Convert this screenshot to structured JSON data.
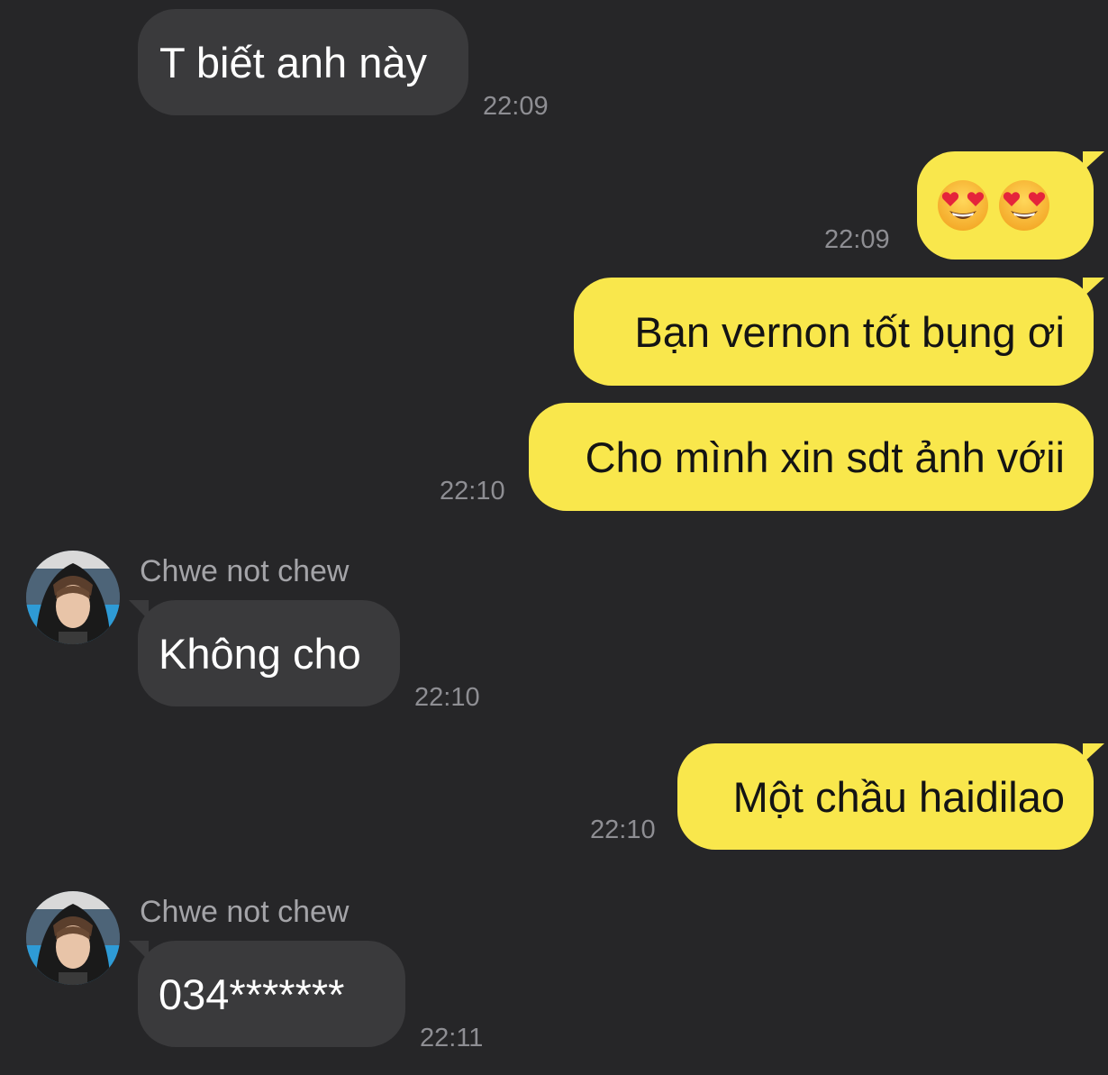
{
  "conversation": {
    "messages": [
      {
        "direction": "in",
        "text": "T biết anh này",
        "time": "22:09"
      },
      {
        "direction": "out",
        "text": "😍😍",
        "time": "22:09"
      },
      {
        "direction": "out",
        "text": "Bạn vernon tốt bụng ơi",
        "time": ""
      },
      {
        "direction": "out",
        "text": "Cho mình xin sdt ảnh vớii",
        "time": "22:10"
      },
      {
        "direction": "in",
        "sender": "Chwe not chew",
        "text": "Không cho",
        "time": "22:10"
      },
      {
        "direction": "out",
        "text": "Một chầu haidilao",
        "time": "22:10"
      },
      {
        "direction": "in",
        "sender": "Chwe not chew",
        "text": "034*******",
        "time": "22:11"
      }
    ]
  },
  "colors": {
    "background": "#262628",
    "incoming_bubble": "#3a3a3c",
    "outgoing_bubble": "#f9e74c",
    "timestamp": "#8e8e93"
  },
  "icons": {
    "heart_eyes": "smiling-face-with-heart-eyes-icon"
  }
}
